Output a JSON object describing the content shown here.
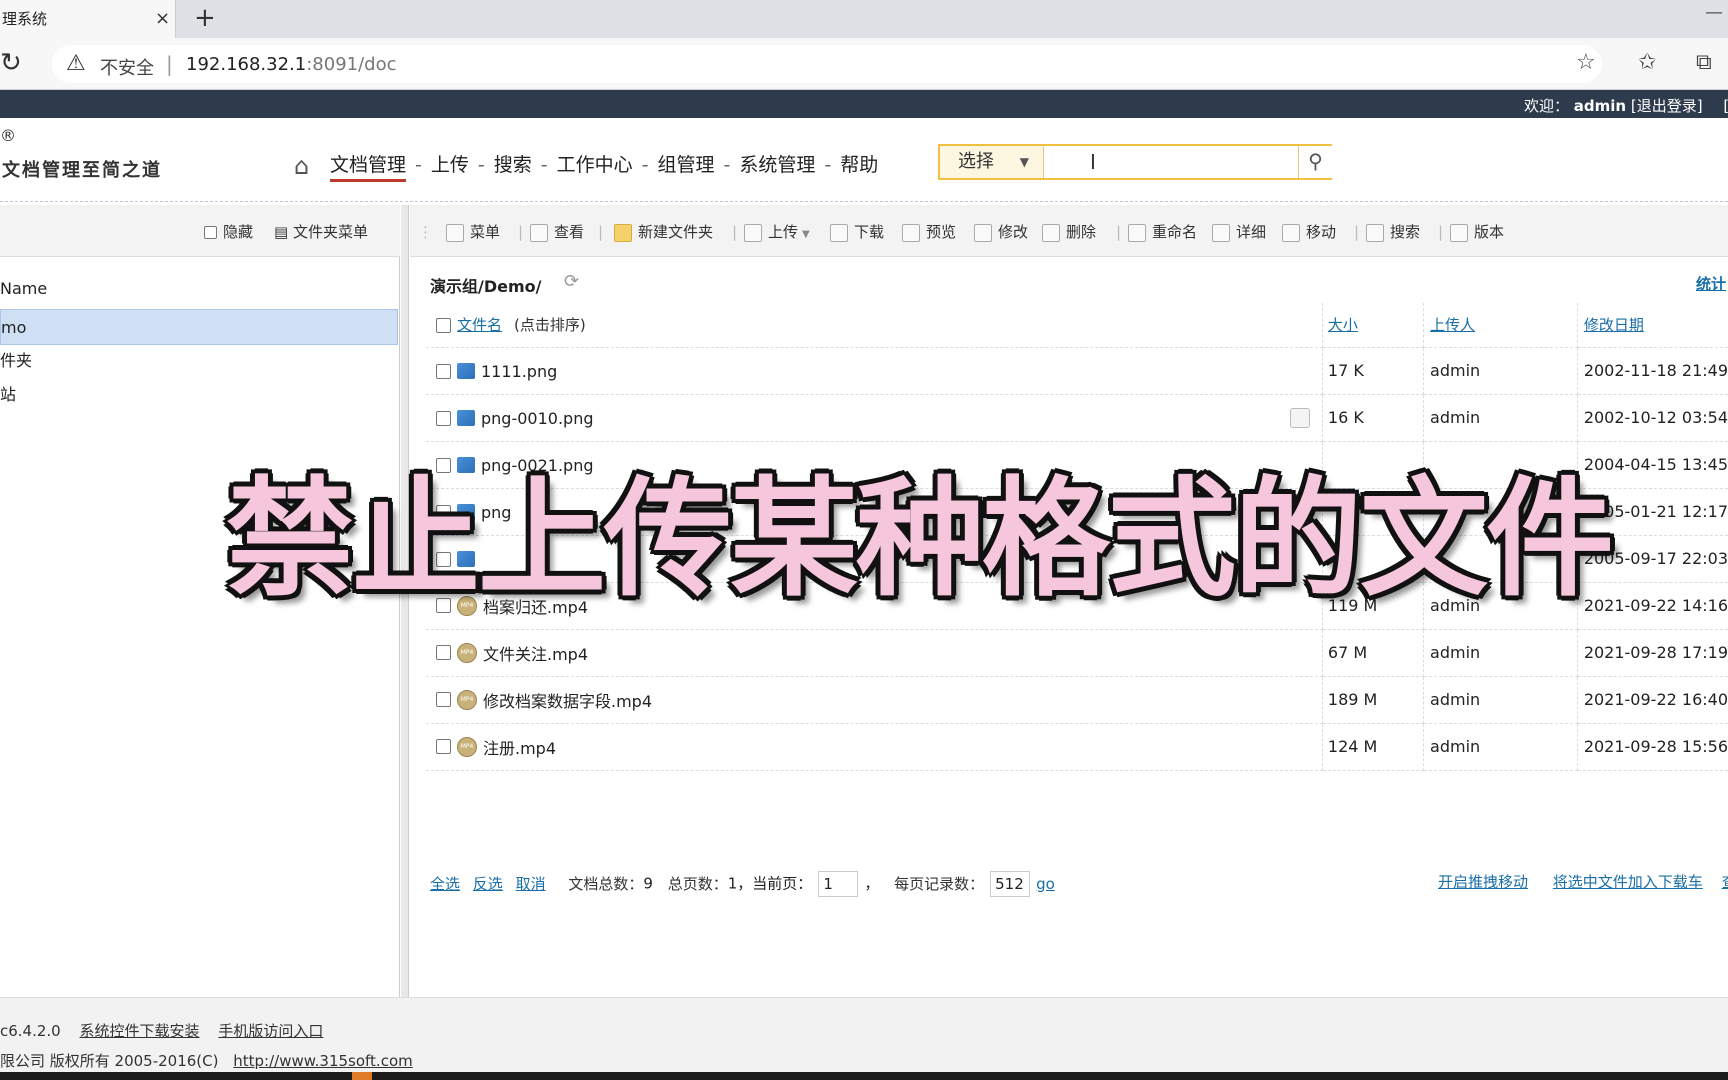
{
  "browser": {
    "tab_title": "理系统",
    "tab_close": "×",
    "new_tab": "+",
    "insecure_label": "不安全",
    "url_host": "192.168.32.1",
    "url_rest": ":8091/doc"
  },
  "topbar": {
    "welcome_prefix": "欢迎：",
    "username": "admin",
    "logout": "[退出登录]",
    "extra": "[?"
  },
  "header": {
    "reg_mark": "®",
    "slogan": "文档管理至简之道",
    "nav": [
      "文档管理",
      "上传",
      "搜索",
      "工作中心",
      "组管理",
      "系统管理",
      "帮助"
    ],
    "search_select": "选择",
    "search_placeholder": ""
  },
  "left_panel": {
    "hide_label": "隐藏",
    "folder_menu_label": "文件夹菜单",
    "tree": [
      {
        "label": "Name",
        "selected": false
      },
      {
        "label": "mo",
        "selected": true
      },
      {
        "label": "件夹",
        "selected": false
      },
      {
        "label": "站",
        "selected": false
      }
    ]
  },
  "toolbar": {
    "items": [
      "菜单",
      "查看",
      "新建文件夹",
      "上传",
      "下载",
      "预览",
      "修改",
      "删除",
      "重命名",
      "详细",
      "移动",
      "搜索",
      "版本"
    ]
  },
  "file_view": {
    "path": "演示组/Demo/",
    "stats_link": "统计",
    "columns": {
      "name": "文件名",
      "name_hint": "(点击排序)",
      "size": "大小",
      "uploader": "上传人",
      "modified": "修改日期"
    },
    "rows": [
      {
        "name": "1111.png",
        "type": "img",
        "size": "17 K",
        "uploader": "admin",
        "modified": "2002-11-18 21:49"
      },
      {
        "name": "png-0010.png",
        "type": "img",
        "size": "16 K",
        "uploader": "admin",
        "modified": "2002-10-12 03:54"
      },
      {
        "name": "png-0021.png",
        "type": "img",
        "size": "",
        "uploader": "",
        "modified": "2004-04-15 13:45"
      },
      {
        "name": "png",
        "type": "img",
        "size": "",
        "uploader": "",
        "modified": "2005-01-21 12:17"
      },
      {
        "name": "",
        "type": "img",
        "size": "",
        "uploader": "",
        "modified": "2005-09-17 22:03"
      },
      {
        "name": "档案归还.mp4",
        "type": "mp4",
        "size": "119 M",
        "uploader": "admin",
        "modified": "2021-09-22 14:16"
      },
      {
        "name": "文件关注.mp4",
        "type": "mp4",
        "size": "67 M",
        "uploader": "admin",
        "modified": "2021-09-28 17:19"
      },
      {
        "name": "修改档案数据字段.mp4",
        "type": "mp4",
        "size": "189 M",
        "uploader": "admin",
        "modified": "2021-09-22 16:40"
      },
      {
        "name": "注册.mp4",
        "type": "mp4",
        "size": "124 M",
        "uploader": "admin",
        "modified": "2021-09-28 15:56"
      }
    ]
  },
  "pager": {
    "select_all": "全选",
    "invert": "反选",
    "cancel": "取消",
    "total_label": "文档总数：",
    "total": "9",
    "pages_label": "总页数：",
    "pages": "1",
    "current_label": "，当前页：",
    "current": "1",
    "per_page_label": "每页记录数：",
    "per_page": "512",
    "go": "go",
    "drag_move": "开启推拽移动",
    "add_cart": "将选中文件加入下载车",
    "view_more": "查看"
  },
  "footer": {
    "version": "c6.4.2.0",
    "plugin_link": "系统控件下载安装",
    "mobile_link": "手机版访问入口",
    "copyright": "限公司 版权所有 2005-2016(C)",
    "site_link": "http://www.315soft.com"
  },
  "overlay": {
    "caption": "禁止上传某种格式的文件"
  },
  "colors": {
    "header_band": "#2d3b4d",
    "link": "#1a6ea8",
    "nav_active_underline": "#c0392b",
    "caption_fill": "#f5c6dc"
  }
}
